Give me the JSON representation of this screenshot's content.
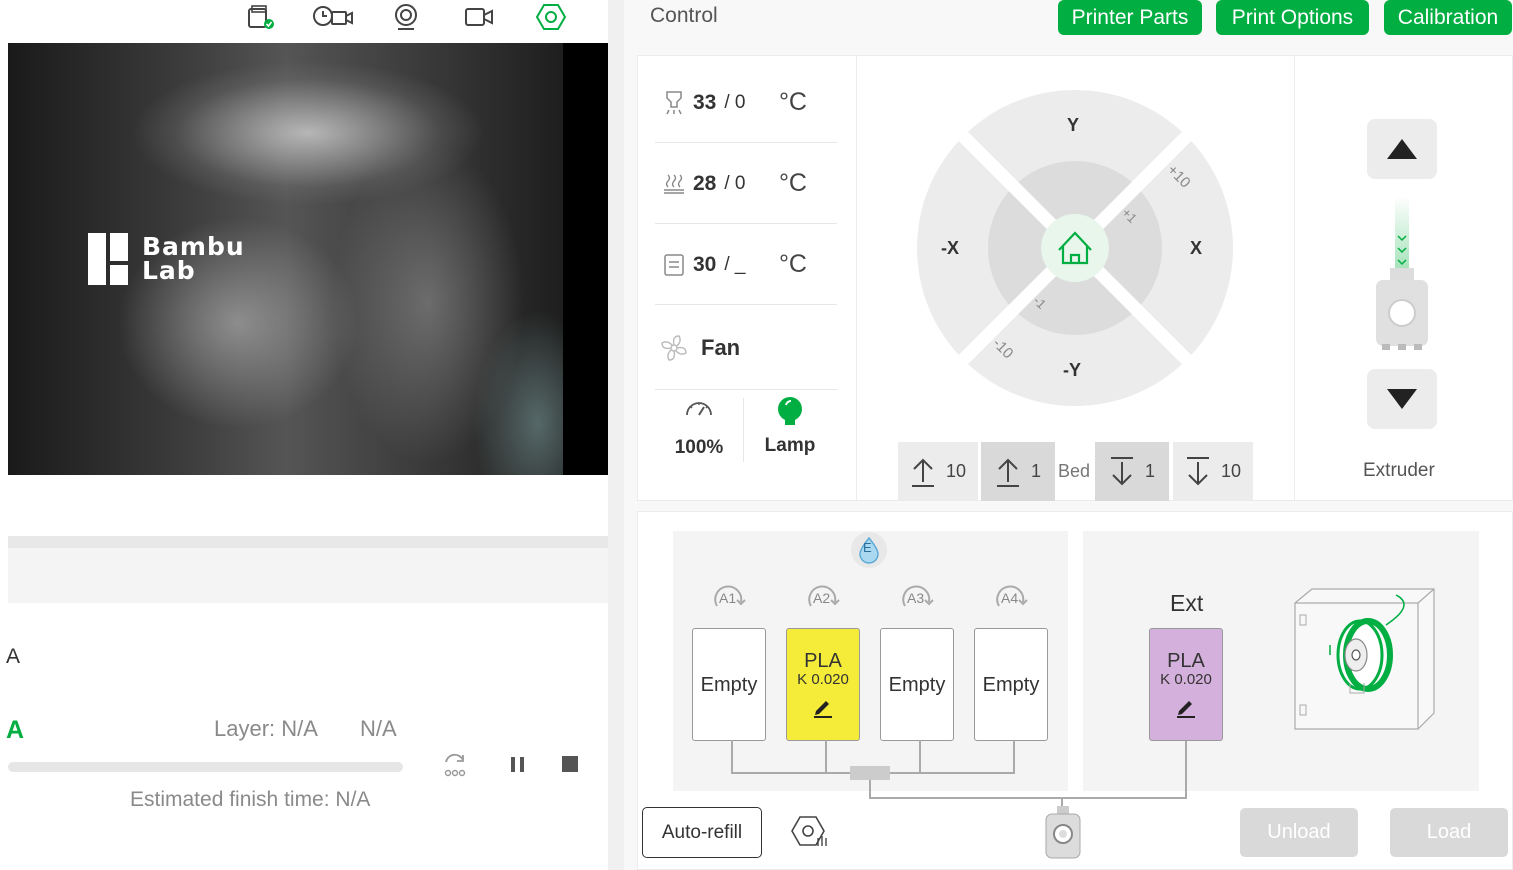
{
  "camera": {
    "logo_line1": "Bambu",
    "logo_line2": "Lab"
  },
  "left": {
    "letter_a1": "A",
    "letter_a2": "A",
    "layer_text": "Layer: N/A",
    "percent_text": "N/A",
    "progress_fraction": 0,
    "estimate_text": "Estimated finish time: N/A"
  },
  "header": {
    "title": "Control",
    "tabs": [
      "Printer Parts",
      "Print Options",
      "Calibration"
    ]
  },
  "temps": {
    "nozzle": {
      "current": "33",
      "target": "/ 0",
      "unit": "°C"
    },
    "bed": {
      "current": "28",
      "target": "/ 0",
      "unit": "°C"
    },
    "chamber": {
      "current": "30",
      "target": "/ _",
      "unit": "°C"
    },
    "fan_label": "Fan",
    "speed_value": "100%",
    "lamp_label": "Lamp"
  },
  "jog": {
    "y_plus": "Y",
    "y_minus": "-Y",
    "x_plus": "X",
    "x_minus": "-X",
    "plus10": "+10",
    "plus1": "+1",
    "minus1": "-1",
    "minus10": "-10",
    "bed_label": "Bed",
    "bed_buttons": [
      "10",
      "1",
      "1",
      "10"
    ]
  },
  "extruder": {
    "label": "Extruder"
  },
  "ams": {
    "e_badge": "E",
    "slot_labels": [
      "A1",
      "A2",
      "A3",
      "A4"
    ],
    "slots": [
      {
        "text": "Empty",
        "k": "",
        "color": "#ffffff"
      },
      {
        "text": "PLA",
        "k": "K 0.020",
        "color": "#f5ec3a"
      },
      {
        "text": "Empty",
        "k": "",
        "color": "#ffffff"
      },
      {
        "text": "Empty",
        "k": "",
        "color": "#ffffff"
      }
    ],
    "ext_title": "Ext",
    "ext_slot": {
      "text": "PLA",
      "k": "K 0.020",
      "color": "#d4b0dc"
    },
    "auto_refill": "Auto-refill",
    "unload": "Unload",
    "load": "Load"
  },
  "colors": {
    "accent": "#00ae42",
    "disabled": "#d9d9d9"
  }
}
